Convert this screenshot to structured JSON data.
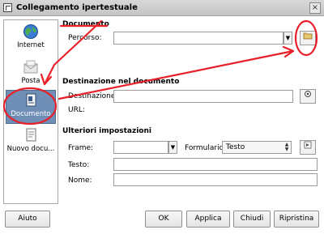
{
  "window": {
    "title": "Collegamento ipertestuale",
    "close_glyph": "×"
  },
  "sidebar": {
    "items": [
      {
        "label": "Internet",
        "icon": "globe-icon"
      },
      {
        "label": "Posta",
        "icon": "mail-icon"
      },
      {
        "label": "Documento",
        "icon": "document-icon",
        "selected": true
      },
      {
        "label": "Nuovo docu...",
        "icon": "new-document-icon"
      }
    ]
  },
  "documento": {
    "section_title": "Documento",
    "percorso_label": "Percorso:",
    "percorso_value": ""
  },
  "destinazione": {
    "section_title": "Destinazione nel documento",
    "destinazione_label": "Destinazione:",
    "destinazione_value": "",
    "url_label": "URL:",
    "url_value": ""
  },
  "ulteriori": {
    "section_title": "Ulteriori impostazioni",
    "frame_label": "Frame:",
    "frame_value": "",
    "formulario_label": "Formulario:",
    "formulario_value": "Testo",
    "testo_label": "Testo:",
    "testo_value": "",
    "nome_label": "Nome:",
    "nome_value": ""
  },
  "buttons": {
    "aiuto": "Aiuto",
    "ok": "OK",
    "applica": "Applica",
    "chiudi": "Chiudi",
    "ripristina": "Ripristina"
  },
  "colors": {
    "annotation": "#e8202a",
    "selected_bg": "#6f8fb6"
  }
}
